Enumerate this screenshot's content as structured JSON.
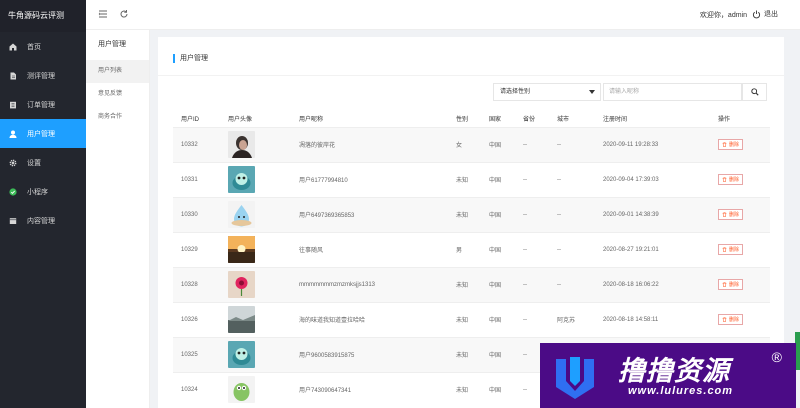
{
  "app": {
    "title": "牛角源码云评测"
  },
  "sidebar": {
    "items": [
      {
        "label": "首页",
        "icon": "home-icon"
      },
      {
        "label": "测评管理",
        "icon": "document-icon"
      },
      {
        "label": "订单管理",
        "icon": "order-icon"
      },
      {
        "label": "用户管理",
        "icon": "user-icon",
        "active": true
      },
      {
        "label": "设置",
        "icon": "gear-icon"
      },
      {
        "label": "小程序",
        "icon": "miniapp-icon"
      },
      {
        "label": "内容管理",
        "icon": "content-icon"
      }
    ]
  },
  "header": {
    "welcome": "欢迎你，admin",
    "logout": "退出"
  },
  "subnav": {
    "title": "用户管理",
    "items": [
      {
        "label": "用户列表",
        "active": true
      },
      {
        "label": "意见反馈"
      },
      {
        "label": "商务合作"
      }
    ]
  },
  "main": {
    "title": "用户管理",
    "filter": {
      "gender_placeholder": "请选择性别",
      "search_placeholder": "请输入昵称"
    }
  },
  "table": {
    "columns": [
      "用户ID",
      "用户头像",
      "用户昵称",
      "性别",
      "国家",
      "省份",
      "城市",
      "注册时间",
      "操作"
    ],
    "delete_label": "删除",
    "rows": [
      {
        "id": "10332",
        "avatar": "portrait",
        "nickname": "凋落的彼岸花",
        "gender": "女",
        "country": "中国",
        "province": "--",
        "city": "--",
        "time": "2020-09-11 19:28:33"
      },
      {
        "id": "10331",
        "avatar": "teal-blob",
        "nickname": "用户61777994810",
        "gender": "未知",
        "country": "中国",
        "province": "--",
        "city": "--",
        "time": "2020-09-04 17:39:03"
      },
      {
        "id": "10330",
        "avatar": "water-drop",
        "nickname": "用户6497369365853",
        "gender": "未知",
        "country": "中国",
        "province": "--",
        "city": "--",
        "time": "2020-09-01 14:38:39"
      },
      {
        "id": "10329",
        "avatar": "sunset",
        "nickname": "往事随风",
        "gender": "男",
        "country": "中国",
        "province": "--",
        "city": "--",
        "time": "2020-08-27 19:21:01"
      },
      {
        "id": "10328",
        "avatar": "pink-flower",
        "nickname": "mmmmmmmzmzmksjjs1313",
        "gender": "未知",
        "country": "中国",
        "province": "--",
        "city": "--",
        "time": "2020-08-18 16:06:22"
      },
      {
        "id": "10326",
        "avatar": "landscape",
        "nickname": "海的味道我知道壹拉哈哈",
        "gender": "未知",
        "country": "中国",
        "province": "--",
        "city": "阿克苏",
        "time": "2020-08-18 14:58:11"
      },
      {
        "id": "10325",
        "avatar": "teal-blob",
        "nickname": "用户9600583915875",
        "gender": "未知",
        "country": "中国",
        "province": "--",
        "city": "--",
        "time": ""
      },
      {
        "id": "10324",
        "avatar": "green-creature",
        "nickname": "用户743090647341",
        "gender": "未知",
        "country": "中国",
        "province": "--",
        "city": "--",
        "time": ""
      }
    ]
  },
  "watermark": {
    "brand": "撸撸资源",
    "reg": "®",
    "url": "www.lulures.com"
  },
  "colors": {
    "accent": "#1e9fff",
    "sidebar_bg": "#23262e",
    "danger": "#ff5722"
  }
}
